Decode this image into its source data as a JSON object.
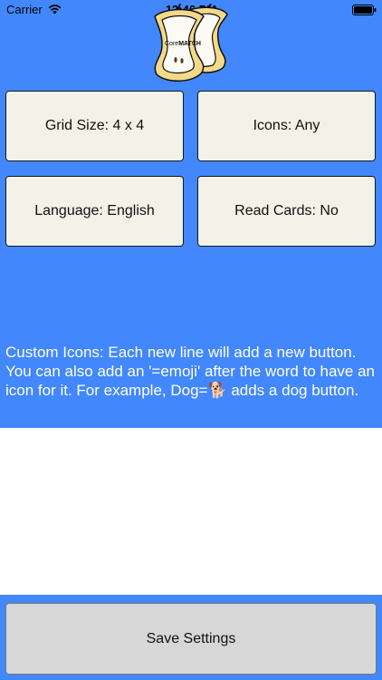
{
  "status_bar": {
    "carrier": "Carrier",
    "time": "12:46 PM"
  },
  "logo": {
    "text_core": "Core",
    "text_match": "MATCH",
    "icon": "apple-core-icon"
  },
  "settings": {
    "grid_size": "Grid Size: 4 x 4",
    "icons": "Icons: Any",
    "language": "Language: English",
    "read_cards": "Read Cards: No"
  },
  "instructions": "Custom Icons: Each new line will add a new button. You can also add an '=emoji' after the word to have an icon for it. For example, Dog=🐕 adds a dog button.",
  "custom_icons_field": {
    "value": ""
  },
  "save_button": {
    "label": "Save Settings"
  },
  "colors": {
    "background_blue": "#4287fb",
    "button_cream": "#f3f2e8",
    "save_button_gray": "#d7d7d7"
  }
}
